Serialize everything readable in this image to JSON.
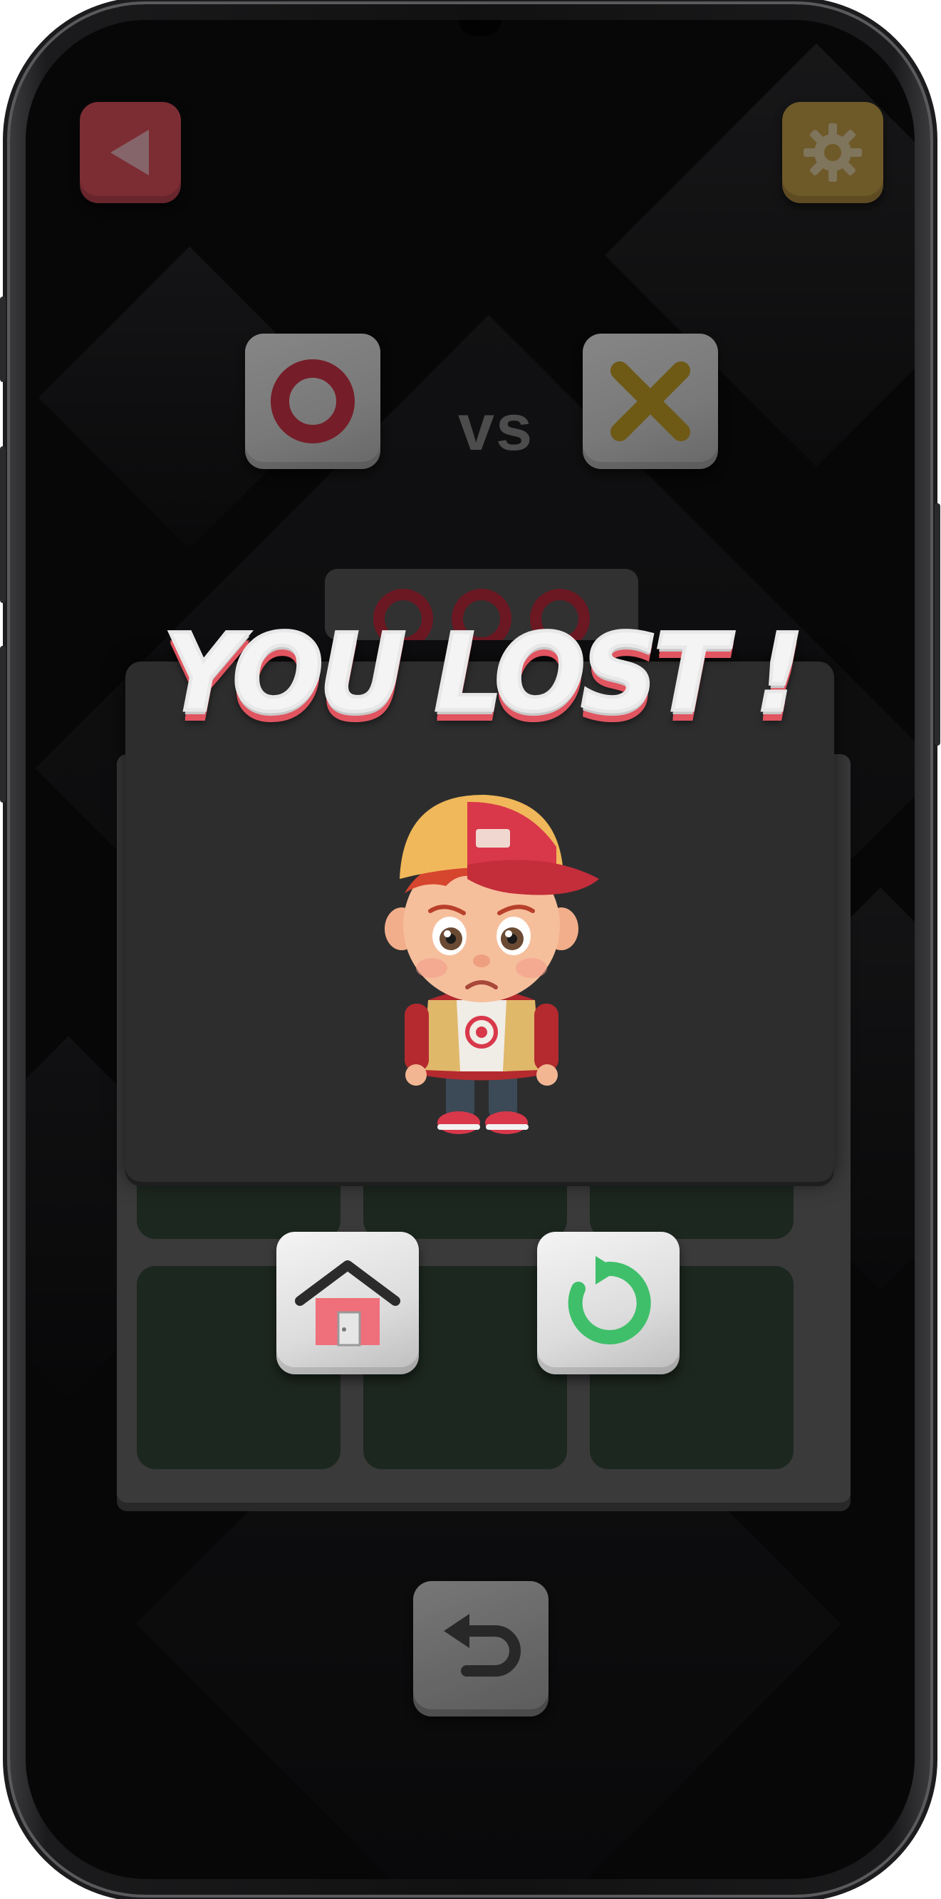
{
  "game": {
    "vs_label": "vs",
    "result_title": "YOU LOST !",
    "player_one_mark": "O",
    "player_two_mark": "X"
  },
  "icons": {
    "back": "back-arrow-icon",
    "settings": "gear-icon",
    "home": "home-icon",
    "restart": "restart-icon",
    "undo": "undo-icon"
  },
  "colors": {
    "back_button": "#e0525e",
    "settings_button": "#c9a24a",
    "o_mark": "#d6354a",
    "x_mark": "#c9a227",
    "restart_arrow": "#3fbf6a",
    "home_roof": "#2b2b2b",
    "home_body": "#ef6f7a"
  }
}
